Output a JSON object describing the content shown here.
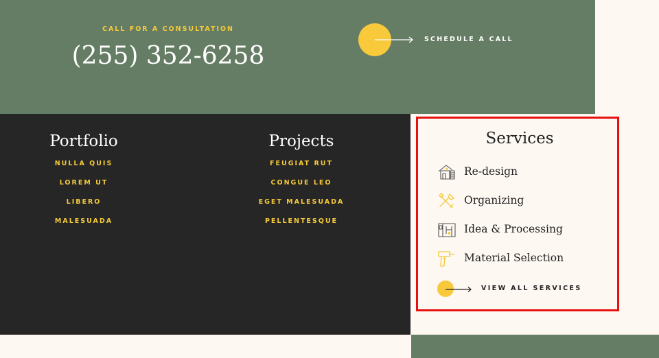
{
  "consultation": {
    "label": "CALL FOR A CONSULTATION",
    "phone": "(255) 352-6258",
    "schedule_label": "SCHEDULE A CALL"
  },
  "portfolio": {
    "title": "Portfolio",
    "links": [
      "NULLA QUIS",
      "LOREM UT",
      "LIBERO",
      "MALESUADA"
    ]
  },
  "projects": {
    "title": "Projects",
    "links": [
      "FEUGIAT RUT",
      "CONGUE LEO",
      "EGET MALESUADA",
      "PELLENTESQUE"
    ]
  },
  "services": {
    "title": "Services",
    "items": [
      {
        "label": "Re-design",
        "icon": "house-redesign-icon"
      },
      {
        "label": "Organizing",
        "icon": "tools-icon"
      },
      {
        "label": "Idea & Processing",
        "icon": "blueprint-icon"
      },
      {
        "label": "Material Selection",
        "icon": "drill-icon"
      }
    ],
    "view_all_label": "VIEW ALL SERVICES"
  },
  "colors": {
    "accent_yellow": "#f7c93b",
    "green": "#667d65",
    "dark": "#262626",
    "cream": "#fdf8f2",
    "highlight_border": "#e8100f"
  }
}
